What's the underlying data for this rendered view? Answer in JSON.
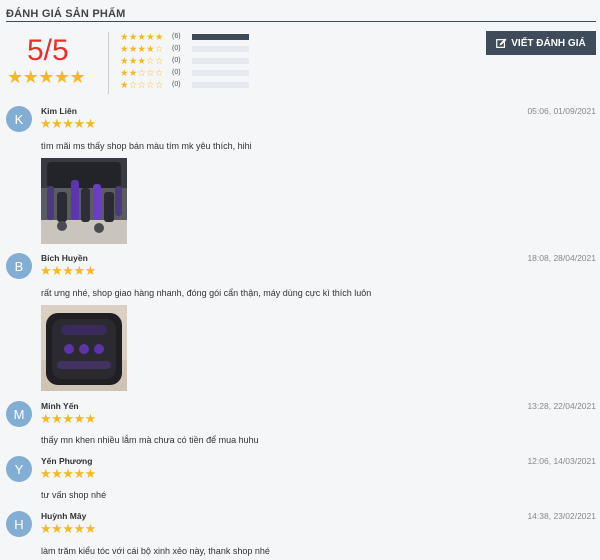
{
  "header": {
    "title": "ĐÁNH GIÁ SẢN PHẨM"
  },
  "summary": {
    "score": "5/5",
    "stars": "★★★★★",
    "breakdown": [
      {
        "stars": "★★★★★",
        "empty": "",
        "count": "(6)",
        "fraction": 1.0
      },
      {
        "stars": "★★★★",
        "empty": "☆",
        "count": "(0)",
        "fraction": 0
      },
      {
        "stars": "★★★",
        "empty": "☆☆",
        "count": "(0)",
        "fraction": 0
      },
      {
        "stars": "★★",
        "empty": "☆☆☆",
        "count": "(0)",
        "fraction": 0
      },
      {
        "stars": "★",
        "empty": "☆☆☆☆",
        "count": "(0)",
        "fraction": 0
      }
    ]
  },
  "write_button": {
    "label": "VIẾT ĐÁNH GIÁ",
    "icon": "edit-icon"
  },
  "colors": {
    "accent": "#3e4b5b",
    "score": "#e8302a",
    "star": "#f5b921",
    "avatar": "#83aed3"
  },
  "reviews": [
    {
      "initial": "K",
      "name": "Kim Liên",
      "stars": "★★★★★",
      "date": "05:06, 01/09/2021",
      "text": "tìm mãi ms thấy shop bán màu tím mk yêu thích, hihi",
      "has_photo": true
    },
    {
      "initial": "B",
      "name": "Bích Huyền",
      "stars": "★★★★★",
      "date": "18:08, 28/04/2021",
      "text": "rất ưng nhé, shop giao hàng nhanh, đóng gói cẩn thận, máy dùng cực kì thích luôn",
      "has_photo": true
    },
    {
      "initial": "M",
      "name": "Minh Yến",
      "stars": "★★★★★",
      "date": "13:28, 22/04/2021",
      "text": "thấy mn khen nhiều lắm mà chưa có tiền để mua huhu",
      "has_photo": false
    },
    {
      "initial": "Y",
      "name": "Yến Phương",
      "stars": "★★★★★",
      "date": "12:06, 14/03/2021",
      "text": "tư vấn shop nhé",
      "has_photo": false
    },
    {
      "initial": "H",
      "name": "Huỳnh Mây",
      "stars": "★★★★★",
      "date": "14:38, 23/02/2021",
      "text": "làm trăm kiểu tóc với cái bộ xinh xẻo này, thank shop nhé",
      "has_photo": false
    }
  ]
}
